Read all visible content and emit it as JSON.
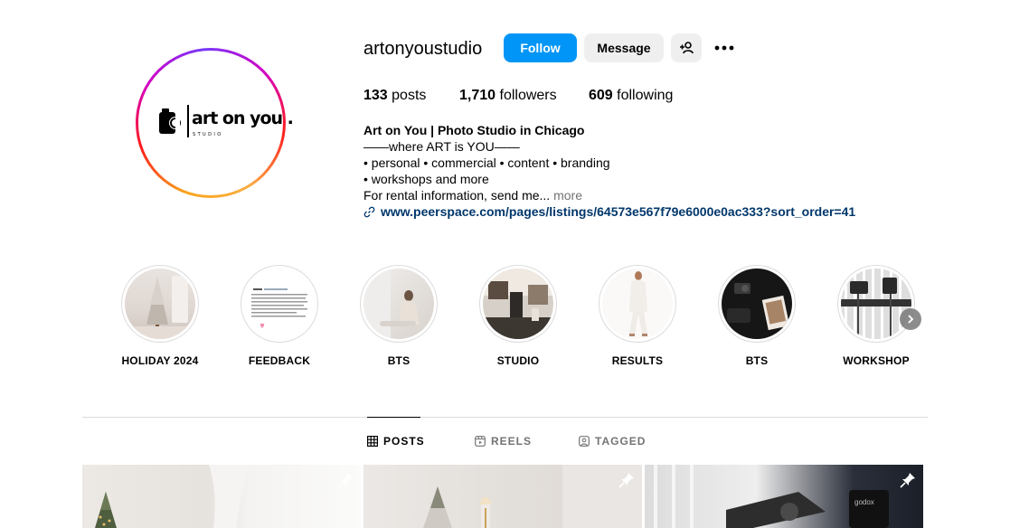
{
  "profile": {
    "username": "artonyoustudio",
    "avatar_logo_text": "art on you .",
    "avatar_logo_sub": "STUDIO"
  },
  "actions": {
    "follow_label": "Follow",
    "message_label": "Message",
    "suggest_icon": "add-person-icon",
    "more_icon": "more-options-icon"
  },
  "stats": {
    "posts_count": "133",
    "posts_label": "posts",
    "followers_count": "1,710",
    "followers_label": "followers",
    "following_count": "609",
    "following_label": "following"
  },
  "bio": {
    "name": "Art on You | Photo Studio in Chicago",
    "line1": "——where ART is YOU——",
    "line2": "• personal • commercial • content • branding",
    "line3": "• workshops and more",
    "line4": "For rental information, send me...",
    "more": "more",
    "link": "www.peerspace.com/pages/listings/64573e567f79e6000e0ac333?sort_order=41"
  },
  "highlights": [
    {
      "label": "HOLIDAY 2024"
    },
    {
      "label": "FEEDBACK"
    },
    {
      "label": "BTS"
    },
    {
      "label": "STUDIO"
    },
    {
      "label": "RESULTS"
    },
    {
      "label": "BTS"
    },
    {
      "label": "WORKSHOP"
    }
  ],
  "tabs": [
    {
      "label": "POSTS",
      "icon": "grid-icon",
      "active": true
    },
    {
      "label": "REELS",
      "icon": "reels-icon",
      "active": false
    },
    {
      "label": "TAGGED",
      "icon": "tagged-icon",
      "active": false
    }
  ],
  "colors": {
    "primary_button": "#0095f6",
    "secondary_button": "#efefef",
    "link": "#00376b",
    "muted": "#737373"
  }
}
